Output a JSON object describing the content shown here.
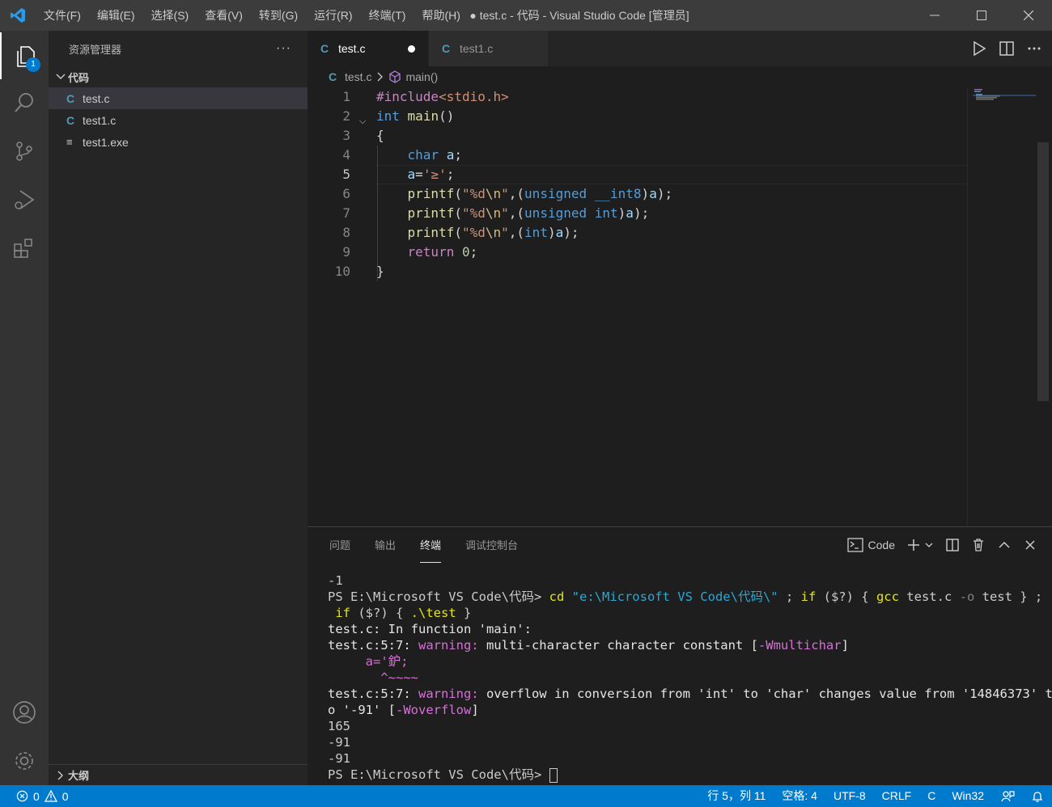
{
  "titlebar": {
    "menu": [
      "文件(F)",
      "编辑(E)",
      "选择(S)",
      "查看(V)",
      "转到(G)",
      "运行(R)",
      "终端(T)",
      "帮助(H)"
    ],
    "title": "● test.c - 代码 - Visual Studio Code [管理员]"
  },
  "activitybar": {
    "explorer_badge": "1"
  },
  "sidebar": {
    "title": "资源管理器",
    "more": "···",
    "folder": "代码",
    "files": [
      {
        "icon": "C",
        "name": "test.c"
      },
      {
        "icon": "C",
        "name": "test1.c"
      },
      {
        "icon": "≡",
        "name": "test1.exe"
      }
    ],
    "outline": "大纲"
  },
  "tabs": [
    {
      "icon": "C",
      "label": "test.c"
    },
    {
      "icon": "C",
      "label": "test1.c"
    }
  ],
  "breadcrumb": {
    "file": "test.c",
    "symbol": "main()"
  },
  "editor": {
    "line_numbers": [
      "1",
      "2",
      "3",
      "4",
      "5",
      "6",
      "7",
      "8",
      "9",
      "10"
    ],
    "current_line": 5
  },
  "panel": {
    "tabs": [
      "问题",
      "输出",
      "终端",
      "调试控制台"
    ],
    "active_tab": "终端",
    "shell": "Code"
  },
  "terminal": {
    "l1": "-1",
    "prompt": "PS E:\\Microsoft VS Code\\代码>",
    "cd": "cd",
    "path_str": "\"e:\\Microsoft VS Code\\代码\\\"",
    "semi": " ; ",
    "if_kw": "if",
    "cond": " ($?) { ",
    "gcc": "gcc",
    "gcc_args": " test.c ",
    "flag_o": "-o",
    "out": " test } ;",
    "if2": " if",
    "cond2": " ($?) { ",
    "run": ".\\test",
    "close": " }",
    "l4": "test.c: In function 'main':",
    "w1_loc": "test.c:5:7: ",
    "w1_tag": "warning:",
    "w1_msg": " multi-character character constant [",
    "w1_flag": "-Wmultichar",
    "w1_end": "]",
    "src_line": "     a='鈩;",
    "caret": "       ^~~~~",
    "w2_loc": "test.c:5:7: ",
    "w2_tag": "warning:",
    "w2_msg": " overflow in conversion from 'int' to 'char' changes value from '14846373' t",
    "w2_cont": "o '-91' [",
    "w2_flag": "-Woverflow",
    "w2_end": "]",
    "out1": "165",
    "out2": "-91",
    "out3": "-91",
    "final_prompt": "PS E:\\Microsoft VS Code\\代码> "
  },
  "statusbar": {
    "errors": "0",
    "warnings": "0",
    "position": "行 5，列 11",
    "spaces": "空格: 4",
    "encoding": "UTF-8",
    "eol": "CRLF",
    "language": "C",
    "platform": "Win32"
  },
  "colors": {
    "accent": "#007acc",
    "activity_bg": "#333333",
    "sidebar_bg": "#252526",
    "editor_bg": "#1e1e1e"
  }
}
